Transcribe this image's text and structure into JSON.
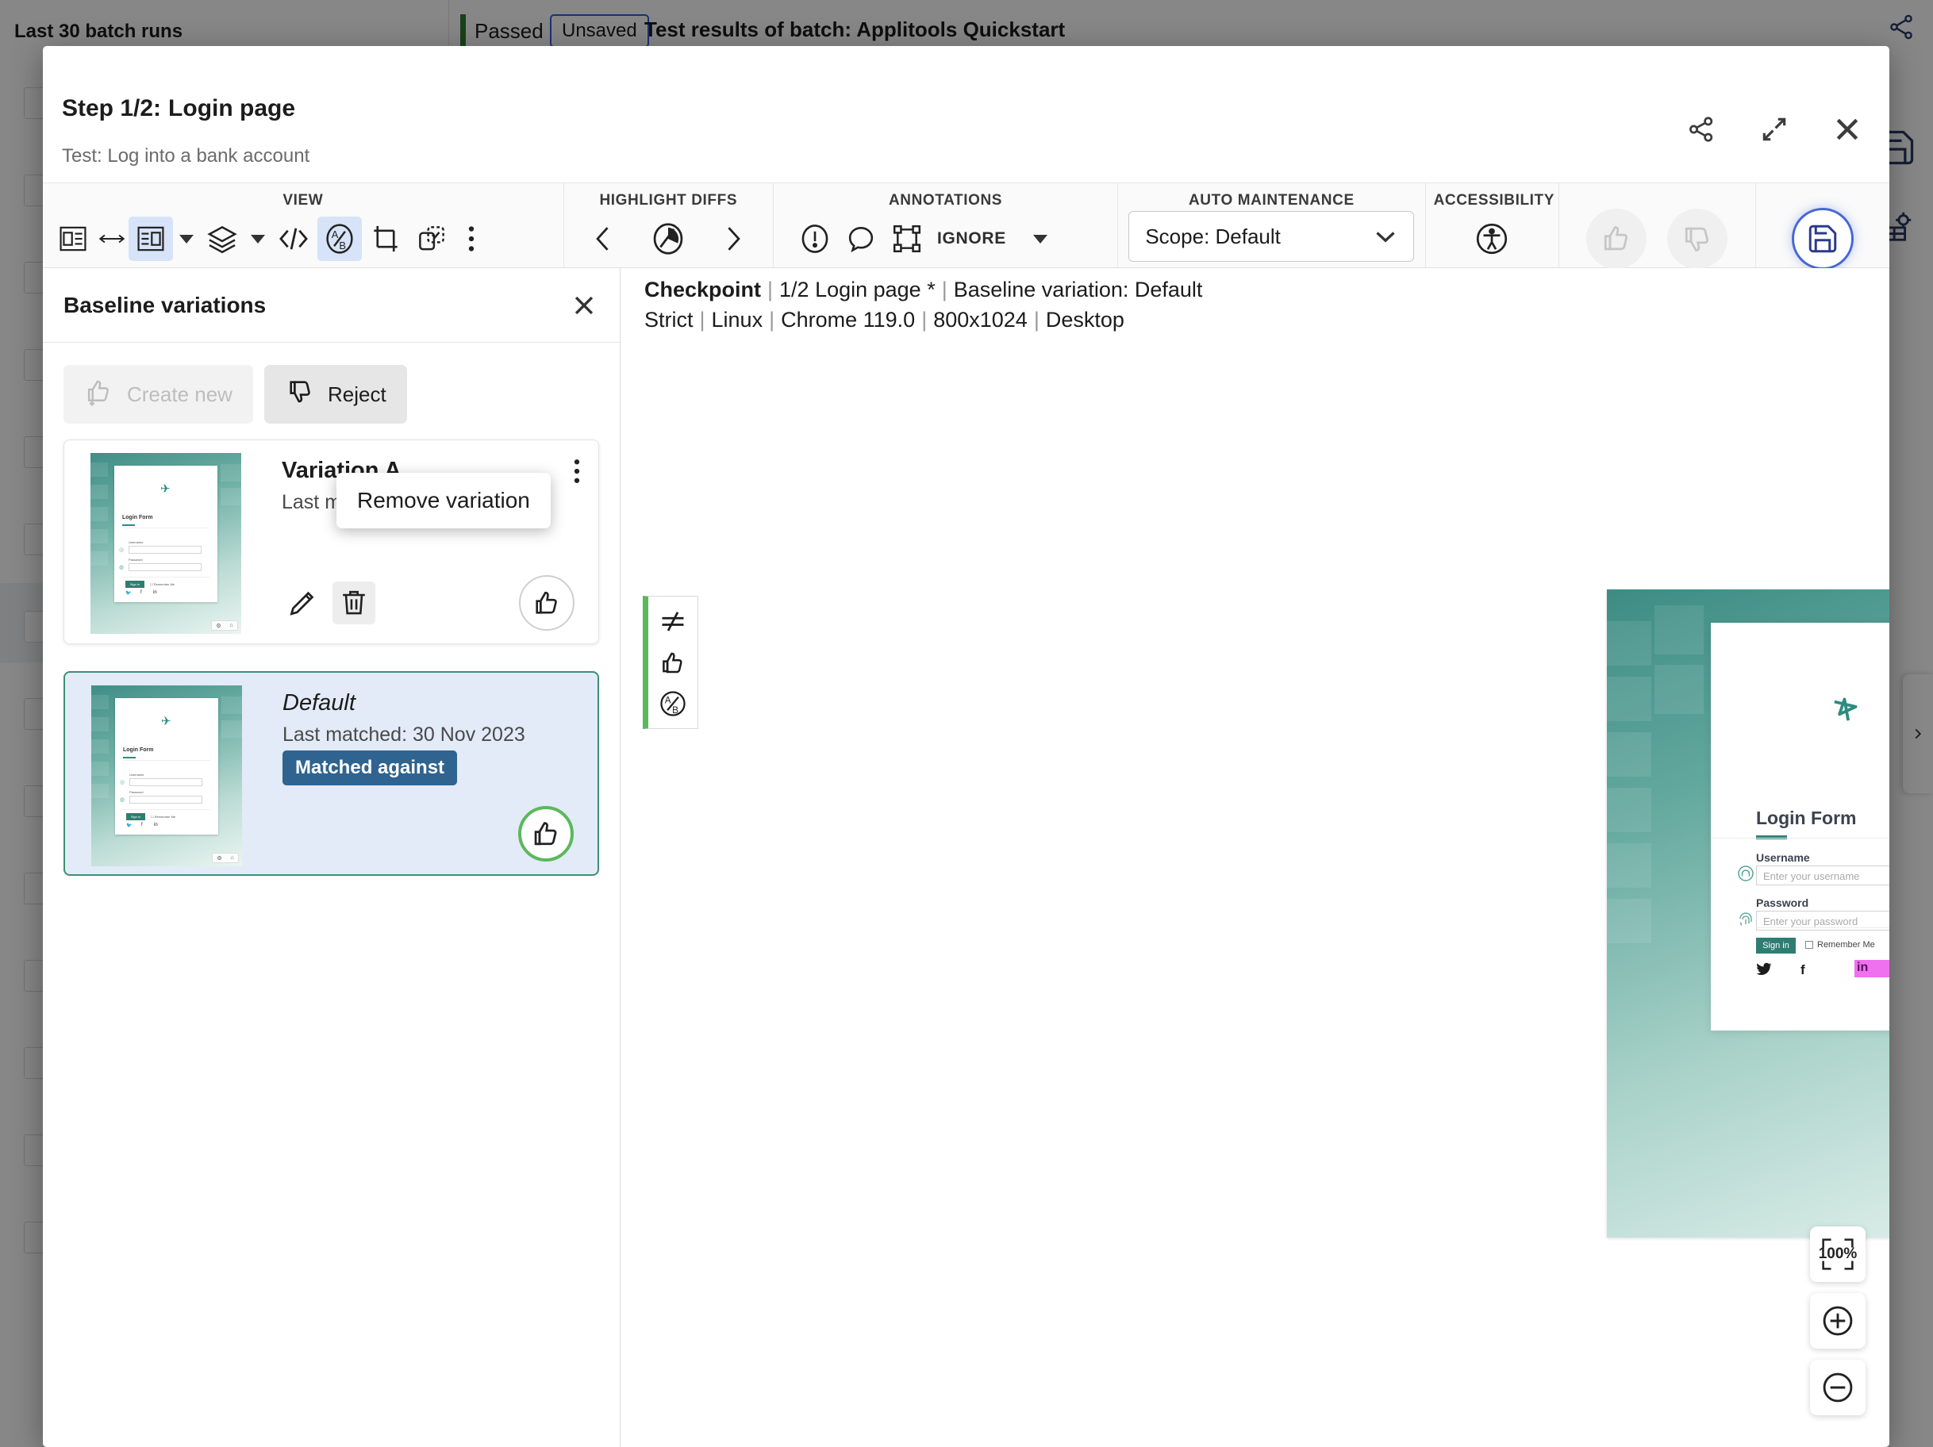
{
  "background": {
    "batch_runs_title": "Last 30 batch runs",
    "status": "Passed",
    "unsaved_badge": "Unsaved",
    "batch_header": "Test results of batch:  Applitools Quickstart"
  },
  "modal": {
    "step_prefix": "Step 1/2:",
    "step_title": "Login page",
    "test_label": "Test: Log into a bank account",
    "header_actions": [
      {
        "name": "share-icon",
        "label": "Share"
      },
      {
        "name": "expand-icon",
        "label": "Expand"
      },
      {
        "name": "close-icon",
        "label": "Close"
      }
    ]
  },
  "toolbar": {
    "groups": [
      {
        "label": "VIEW",
        "items": [
          {
            "name": "side-by-side-icon",
            "selected": false
          },
          {
            "name": "swap-arrows-icon",
            "selected": false
          },
          {
            "name": "single-view-icon",
            "selected": true
          },
          {
            "name": "view-caret-icon",
            "selected": false
          },
          {
            "name": "layers-icon",
            "selected": false
          },
          {
            "name": "layers-caret-icon",
            "selected": false
          },
          {
            "name": "code-icon",
            "selected": false
          },
          {
            "name": "ab-compare-icon",
            "selected": true
          },
          {
            "name": "crop-icon",
            "selected": false
          },
          {
            "name": "region-select-icon",
            "selected": false
          },
          {
            "name": "more-options-icon",
            "selected": false
          }
        ]
      },
      {
        "label": "HIGHLIGHT DIFFS",
        "items": [
          {
            "name": "prev-diff-icon",
            "selected": false
          },
          {
            "name": "diff-target-icon",
            "selected": false
          },
          {
            "name": "next-diff-icon",
            "selected": false
          }
        ]
      },
      {
        "label": "ANNOTATIONS",
        "ignore_label": "IGNORE",
        "items": [
          {
            "name": "exclamation-icon",
            "selected": false
          },
          {
            "name": "comment-icon",
            "selected": false
          },
          {
            "name": "ignore-region-icon",
            "selected": false
          },
          {
            "name": "annotations-caret-icon",
            "selected": false
          }
        ]
      },
      {
        "label": "AUTO MAINTENANCE",
        "scope_value": "Scope: Default"
      },
      {
        "label": "ACCESSIBILITY",
        "items": [
          {
            "name": "accessibility-icon",
            "selected": false
          }
        ]
      }
    ],
    "thumbs_up": "thumbs-up-icon",
    "thumbs_down": "thumbs-down-icon",
    "save": "save-icon"
  },
  "side_panel": {
    "title": "Baseline variations",
    "close_icon": "close-icon",
    "create_new_label": "Create new",
    "reject_label": "Reject",
    "tooltip": "Remove variation",
    "cards": [
      {
        "name": "Variation A",
        "date": "Last matched: 1 Mar 2024",
        "italic": false,
        "badge": null,
        "active": false,
        "approved": false
      },
      {
        "name": "Default",
        "date": "Last matched: 30 Nov 2023",
        "italic": true,
        "badge": "Matched against",
        "active": true,
        "approved": true
      }
    ],
    "card_icons": {
      "edit": "pencil-icon",
      "delete": "trash-icon",
      "approve": "thumbs-up-icon",
      "menu": "kebab-menu-icon"
    }
  },
  "viewer": {
    "checkpoint_label": "Checkpoint",
    "step_name": "1/2 Login page *",
    "baseline_variation": "Baseline variation: Default",
    "match_level": "Strict",
    "os": "Linux",
    "browser": "Chrome 119.0",
    "viewport": "800x1024",
    "device": "Desktop",
    "separator": "|",
    "flags": [
      {
        "name": "not-equal-icon"
      },
      {
        "name": "thumbs-up-icon"
      },
      {
        "name": "ab-compare-icon"
      }
    ],
    "zoom_controls": {
      "fit_label": "100%",
      "zoom_in": "zoom-in-icon",
      "zoom_out": "zoom-out-icon"
    }
  },
  "screenshot": {
    "form_title": "Login Form",
    "username_label": "Username",
    "username_placeholder": "Enter your username",
    "password_label": "Password",
    "password_placeholder": "Enter your password",
    "signin_label": "Sign in",
    "remember_label": "Remember Me",
    "social": [
      {
        "name": "twitter-icon",
        "glyph": "🐦"
      },
      {
        "name": "facebook-icon",
        "glyph": "f"
      },
      {
        "name": "linkedin-icon",
        "glyph": "in"
      }
    ],
    "diff_highlight_color": "#ef71ef",
    "brand_color": "#2e8b80"
  }
}
